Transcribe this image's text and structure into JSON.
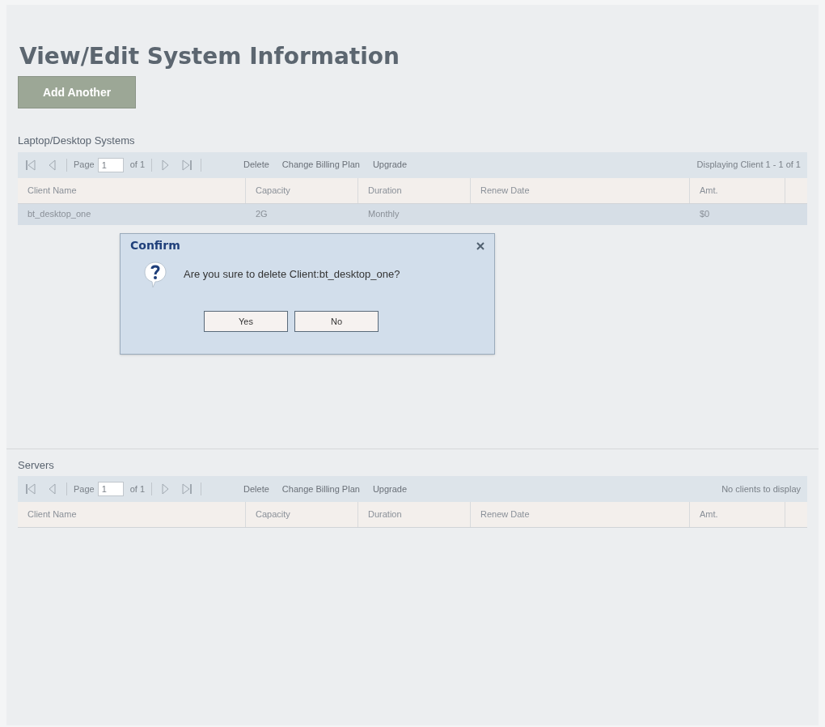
{
  "page": {
    "title": "View/Edit System Information",
    "add_button": "Add Another"
  },
  "grids": [
    {
      "title": "Laptop/Desktop Systems",
      "pager": {
        "page_label": "Page",
        "page": "1",
        "of": "of 1"
      },
      "actions": [
        "Delete",
        "Change Billing Plan",
        "Upgrade"
      ],
      "status": "Displaying Client 1 - 1 of 1",
      "columns": [
        "Client Name",
        "Capacity",
        "Duration",
        "Renew Date",
        "Amt."
      ],
      "rows": [
        {
          "cells": [
            "bt_desktop_one",
            "2G",
            "Monthly",
            "",
            "$0"
          ],
          "selected": true
        }
      ]
    },
    {
      "title": "Servers",
      "pager": {
        "page_label": "Page",
        "page": "1",
        "of": "of 1"
      },
      "actions": [
        "Delete",
        "Change Billing Plan",
        "Upgrade"
      ],
      "status": "No clients to display",
      "columns": [
        "Client Name",
        "Capacity",
        "Duration",
        "Renew Date",
        "Amt."
      ]
    }
  ],
  "dialog": {
    "title": "Confirm",
    "message": "Are you sure to delete Client:bt_desktop_one?",
    "buttons": [
      "Yes",
      "No"
    ]
  }
}
